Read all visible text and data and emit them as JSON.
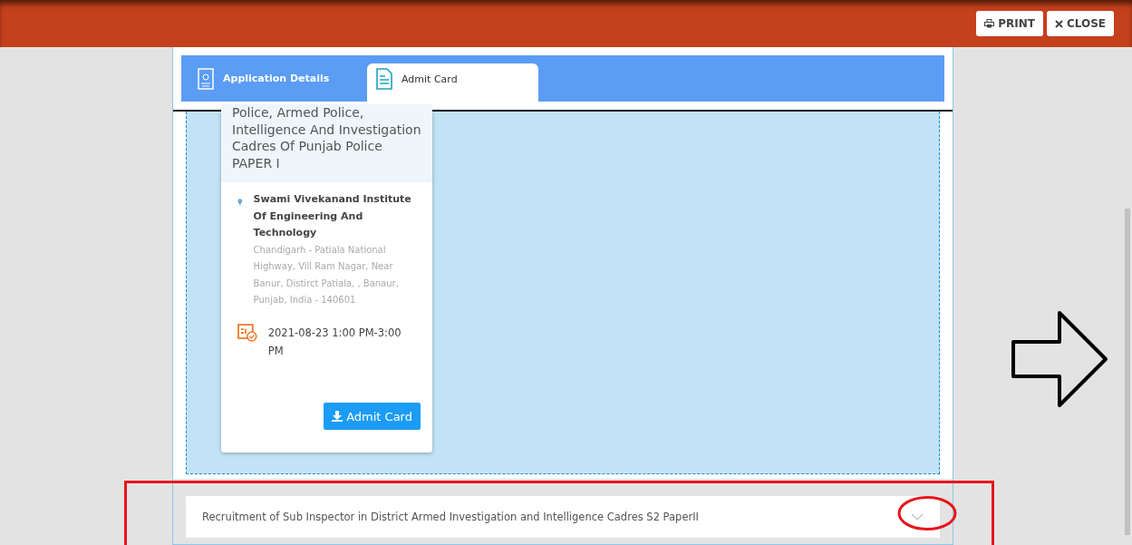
{
  "toolbar": {
    "buttons": [
      {
        "kind": "print",
        "label": "PRINT"
      },
      {
        "kind": "close",
        "label": "CLOSE"
      }
    ]
  },
  "tabs": [
    {
      "label": "Application Details",
      "kind": "application",
      "selected": false
    },
    {
      "label": "Admit Card",
      "kind": "document",
      "selected": true
    }
  ],
  "exam_card": {
    "title": "Police, Armed Police, Intelligence And Investigation Cadres Of Punjab Police PAPER I",
    "centre_name": "Swami Vivekanand Institute Of Engineering And Technology",
    "centre_address": "Chandigarh - Patiala National Highway, Vill Ram Nagar, Near Banur, Distirct Patiala, , Banaur, Punjab, India - 140601",
    "schedule": "2021-08-23 1:00 PM-3:00 PM",
    "button": "Admit Card"
  },
  "accordion": {
    "title": "Recruitment of Sub Inspector in District Armed Investigation and Intelligence Cadres S2 PaperII",
    "expanded": false
  }
}
